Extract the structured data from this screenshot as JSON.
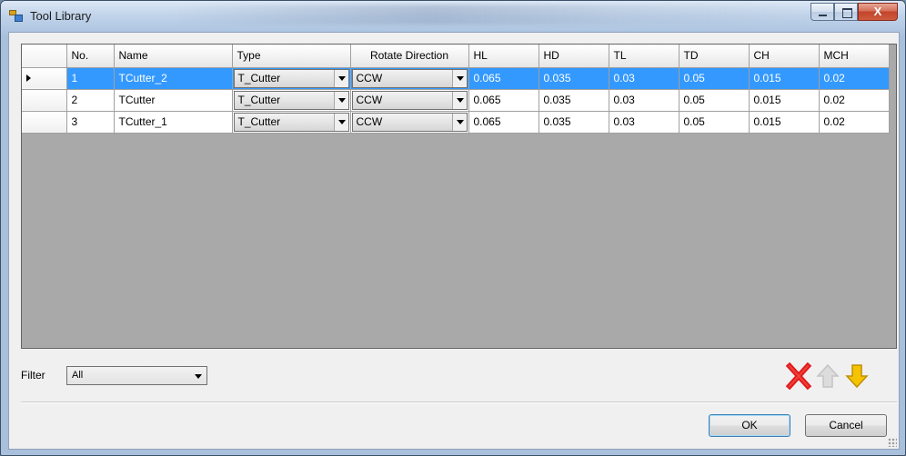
{
  "window": {
    "title": "Tool Library",
    "minimize_glyph": "",
    "maximize_glyph": "",
    "close_glyph": "X"
  },
  "grid": {
    "columns": [
      "No.",
      "Name",
      "Type",
      "Rotate Direction",
      "HL",
      "HD",
      "TL",
      "TD",
      "CH",
      "MCH"
    ],
    "selected_row_index": 0,
    "rows": [
      {
        "no": "1",
        "name": "TCutter_2",
        "type": "T_Cutter",
        "rotate": "CCW",
        "hl": "0.065",
        "hd": "0.035",
        "tl": "0.03",
        "td": "0.05",
        "ch": "0.015",
        "mch": "0.02"
      },
      {
        "no": "2",
        "name": "TCutter",
        "type": "T_Cutter",
        "rotate": "CCW",
        "hl": "0.065",
        "hd": "0.035",
        "tl": "0.03",
        "td": "0.05",
        "ch": "0.015",
        "mch": "0.02"
      },
      {
        "no": "3",
        "name": "TCutter_1",
        "type": "T_Cutter",
        "rotate": "CCW",
        "hl": "0.065",
        "hd": "0.035",
        "tl": "0.03",
        "td": "0.05",
        "ch": "0.015",
        "mch": "0.02"
      }
    ]
  },
  "filter": {
    "label": "Filter",
    "value": "All"
  },
  "toolbar": {
    "delete_icon": "delete-x-icon",
    "up_icon": "arrow-up-icon",
    "down_icon": "arrow-down-icon",
    "delete_color": "#e01b1b",
    "up_enabled": false,
    "down_color": "#f5c400"
  },
  "buttons": {
    "ok": "OK",
    "cancel": "Cancel"
  },
  "colors": {
    "selection": "#3399ff",
    "grid_background": "#a9a9a9"
  }
}
